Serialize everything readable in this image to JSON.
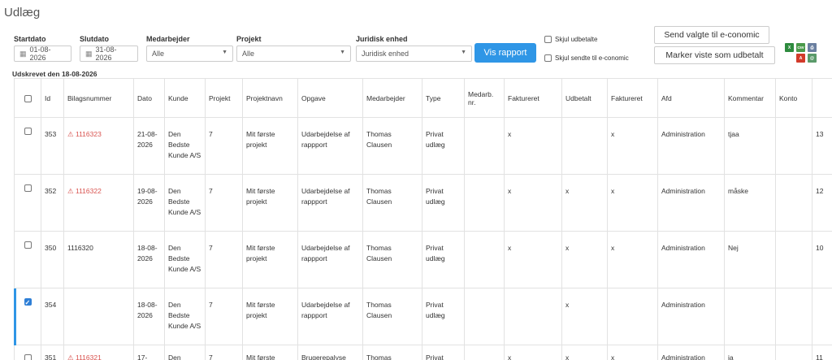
{
  "page": {
    "title": "Udlæg"
  },
  "filters": {
    "startdato": {
      "label": "Startdato",
      "value": "01-08-2026"
    },
    "slutdato": {
      "label": "Slutdato",
      "value": "31-08-2026"
    },
    "medarbejder": {
      "label": "Medarbejder",
      "value": "Alle"
    },
    "projekt": {
      "label": "Projekt",
      "value": "Alle"
    },
    "juridisk_enhed": {
      "label": "Juridisk enhed",
      "value": "Juridisk enhed"
    }
  },
  "actions": {
    "vis_rapport": "Vis rapport",
    "skjul_udbetalte": "Skjul udbetalte",
    "skjul_sendte": "Skjul sendte til e-conomic",
    "send_valgte": "Send valgte til e-conomic",
    "marker_udbetalt": "Marker viste som udbetalt"
  },
  "export": {
    "excel": "X",
    "csv": "csv",
    "print": "⎙",
    "pdf": "A",
    "mail": "@"
  },
  "printed": "Udskrevet den 18-08-2026",
  "table": {
    "headers": [
      "Id",
      "Bilagsnummer",
      "Dato",
      "Kunde",
      "Projekt",
      "Projektnavn",
      "Opgave",
      "Medarbejder",
      "Type",
      "Medarb. nr.",
      "Faktureret",
      "Udbetalt",
      "Faktureret",
      "Afd",
      "Kommentar",
      "Konto",
      ""
    ],
    "rows": [
      {
        "checked": false,
        "id": "353",
        "bilag": "1116323",
        "bilag_warning": true,
        "dato": "21-08-2026",
        "kunde": "Den Bedste Kunde A/S",
        "projekt": "7",
        "projektnavn": "Mit første projekt",
        "opgave": "Udarbejdelse af rappport",
        "medarbejder": "Thomas Clausen",
        "type": "Privat udlæg",
        "medarb_nr": "",
        "fakturerbar": "x",
        "udbetalt": "",
        "faktureret": "x",
        "afd": "Administration",
        "kommentar": "tjaa",
        "konto": "",
        "extra": "13"
      },
      {
        "checked": false,
        "id": "352",
        "bilag": "1116322",
        "bilag_warning": true,
        "dato": "19-08-2026",
        "kunde": "Den Bedste Kunde A/S",
        "projekt": "7",
        "projektnavn": "Mit første projekt",
        "opgave": "Udarbejdelse af rappport",
        "medarbejder": "Thomas Clausen",
        "type": "Privat udlæg",
        "medarb_nr": "",
        "fakturerbar": "x",
        "udbetalt": "x",
        "faktureret": "x",
        "afd": "Administration",
        "kommentar": "måske",
        "konto": "",
        "extra": "12"
      },
      {
        "checked": false,
        "id": "350",
        "bilag": "1116320",
        "bilag_warning": false,
        "dato": "18-08-2026",
        "kunde": "Den Bedste Kunde A/S",
        "projekt": "7",
        "projektnavn": "Mit første projekt",
        "opgave": "Udarbejdelse af rappport",
        "medarbejder": "Thomas Clausen",
        "type": "Privat udlæg",
        "medarb_nr": "",
        "fakturerbar": "x",
        "udbetalt": "x",
        "faktureret": "x",
        "afd": "Administration",
        "kommentar": "Nej",
        "konto": "",
        "extra": "10"
      },
      {
        "checked": true,
        "id": "354",
        "bilag": "",
        "bilag_warning": false,
        "dato": "18-08-2026",
        "kunde": "Den Bedste Kunde A/S",
        "projekt": "7",
        "projektnavn": "Mit første projekt",
        "opgave": "Udarbejdelse af rappport",
        "medarbejder": "Thomas Clausen",
        "type": "Privat udlæg",
        "medarb_nr": "",
        "fakturerbar": "",
        "udbetalt": "x",
        "faktureret": "",
        "afd": "Administration",
        "kommentar": "",
        "konto": "",
        "extra": ""
      },
      {
        "checked": false,
        "id": "351",
        "bilag": "1116321",
        "bilag_warning": true,
        "dato": "17-",
        "kunde": "Den",
        "projekt": "7",
        "projektnavn": "Mit første",
        "opgave": "Brugerepalyse",
        "medarbejder": "Thomas",
        "type": "Privat",
        "medarb_nr": "",
        "fakturerbar": "x",
        "udbetalt": "x",
        "faktureret": "x",
        "afd": "Administration",
        "kommentar": "ja",
        "konto": "",
        "extra": "11"
      }
    ]
  }
}
